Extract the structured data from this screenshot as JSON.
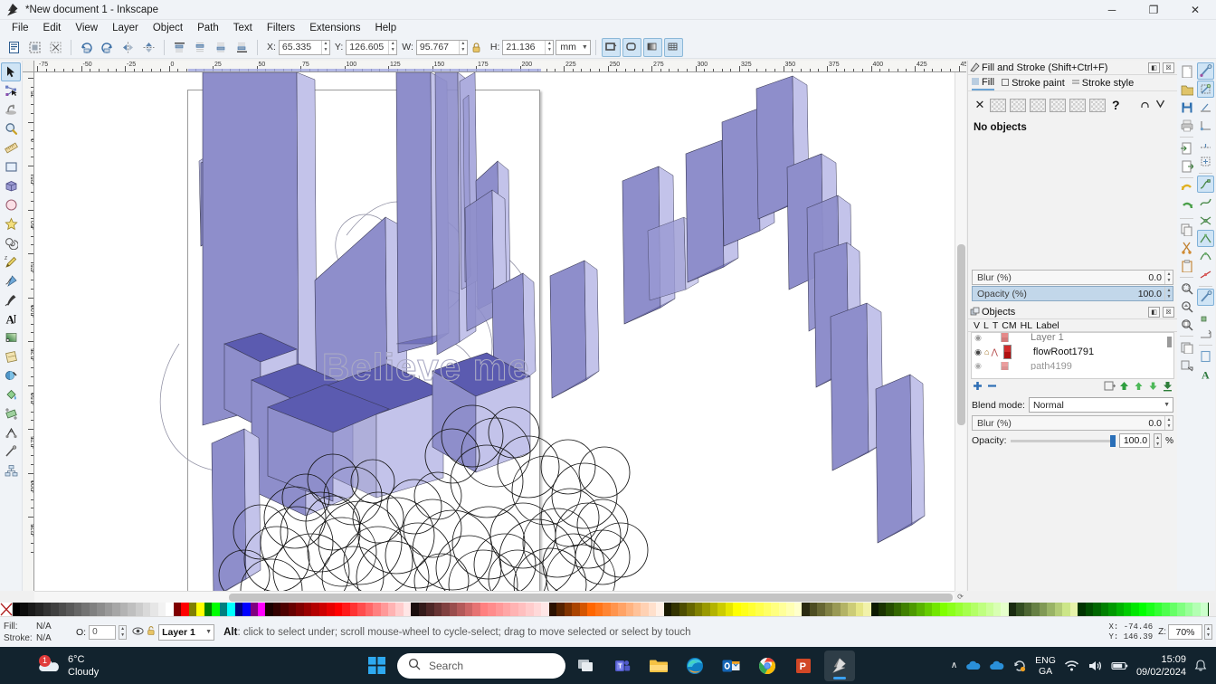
{
  "window": {
    "title": "*New document 1 - Inkscape",
    "minimize": "─",
    "maximize": "❐",
    "close": "✕"
  },
  "menu": {
    "items": [
      "File",
      "Edit",
      "View",
      "Layer",
      "Object",
      "Path",
      "Text",
      "Filters",
      "Extensions",
      "Help"
    ]
  },
  "toolbar": {
    "x_label": "X:",
    "x_value": "65.335",
    "y_label": "Y:",
    "y_value": "126.605",
    "w_label": "W:",
    "w_value": "95.767",
    "h_label": "H:",
    "h_value": "21.136",
    "unit": "mm",
    "lock_icon": "lock-icon",
    "buttons": [
      "select-all-icon",
      "select-all-layers-icon",
      "deselect-icon",
      "rotate-90-ccw-icon",
      "rotate-90-cw-icon",
      "flip-horizontal-icon",
      "flip-vertical-icon",
      "raise-to-top-icon",
      "raise-icon",
      "lower-icon",
      "lower-to-bottom-icon"
    ],
    "right_buttons": [
      "transform-stroke-icon",
      "transform-corners-icon",
      "transform-gradients-icon",
      "transform-patterns-icon"
    ]
  },
  "toolbox": {
    "tools": [
      {
        "name": "selector-tool",
        "selected": true
      },
      {
        "name": "node-tool",
        "selected": false
      },
      {
        "name": "tweak-tool",
        "selected": false
      },
      {
        "name": "zoom-tool",
        "selected": false
      },
      {
        "name": "measure-tool",
        "selected": false
      },
      {
        "name": "rectangle-tool",
        "selected": false
      },
      {
        "name": "3dbox-tool",
        "selected": false
      },
      {
        "name": "ellipse-tool",
        "selected": false
      },
      {
        "name": "star-tool",
        "selected": false
      },
      {
        "name": "spiral-tool",
        "selected": false
      },
      {
        "name": "pencil-tool",
        "selected": false
      },
      {
        "name": "bezier-tool",
        "selected": false
      },
      {
        "name": "calligraphy-tool",
        "selected": false
      },
      {
        "name": "text-tool",
        "selected": false
      },
      {
        "name": "gradient-tool",
        "selected": false
      },
      {
        "name": "mesh-tool",
        "selected": false
      },
      {
        "name": "dropper-tool",
        "selected": false
      },
      {
        "name": "paintbucket-tool",
        "selected": false
      },
      {
        "name": "eraser-tool",
        "selected": false
      },
      {
        "name": "connector-tool",
        "selected": false
      },
      {
        "name": "lpe-tool",
        "selected": false
      },
      {
        "name": "diagram-tool",
        "selected": false
      }
    ]
  },
  "rulers": {
    "h_labels": [
      "-75",
      "-50",
      "-25",
      "0",
      "25",
      "50",
      "75",
      "100",
      "125",
      "150",
      "175",
      "200",
      "225",
      "250",
      "275",
      "300",
      "325",
      "350",
      "375",
      "400",
      "425",
      "450"
    ],
    "v_labels": [
      "25",
      "0",
      "-25",
      "-50",
      "-75",
      "-100",
      "-125",
      "-150",
      "-175",
      "-200",
      "-225"
    ]
  },
  "canvas": {
    "artwork_text": "Believe me",
    "colors": {
      "box_front": "#8e8ecb",
      "box_top": "#5b5bb0",
      "box_side": "#c3c3ea",
      "box_light": "#a5a5da",
      "scribble_stroke": "#1a1a1a",
      "spiral_stroke": "#8b8b9e"
    }
  },
  "fill_stroke_panel": {
    "title": "Fill and Stroke (Shift+Ctrl+F)",
    "dock_icon": "fill-stroke-icon",
    "tabs": [
      {
        "label": "Fill",
        "icon": "fill-icon",
        "active": true
      },
      {
        "label": "Stroke paint",
        "icon": "stroke-paint-icon",
        "active": false
      },
      {
        "label": "Stroke style",
        "icon": "stroke-style-icon",
        "active": false
      }
    ],
    "paint_buttons": [
      "no-paint-icon",
      "flat-color-icon",
      "linear-gradient-icon",
      "radial-gradient-icon",
      "pattern-icon",
      "swatch-icon",
      "unknown-icon"
    ],
    "help_glyph": "?",
    "rule_icons": [
      "fill-rule-even-odd-icon",
      "fill-rule-nonzero-icon"
    ],
    "status": "No objects",
    "blur_label": "Blur (%)",
    "blur_value": "0.0",
    "opacity_label": "Opacity (%)",
    "opacity_value": "100.0",
    "minimize": "◧",
    "close": "☒"
  },
  "objects_panel": {
    "title": "Objects",
    "dock_icon": "objects-icon",
    "columns": [
      "V",
      "L",
      "T",
      "CM",
      "HL",
      "Label"
    ],
    "rows": [
      {
        "label": "Layer 1",
        "visible": true,
        "locked": false
      },
      {
        "label": "flowRoot1791",
        "visible": true,
        "locked": false
      },
      {
        "label": "path4199",
        "visible": true,
        "locked": false
      }
    ],
    "row_buttons": [
      "add-object-icon",
      "remove-object-icon",
      "new-group-icon",
      "move-to-top-icon",
      "raise-icon",
      "lower-icon",
      "move-to-bottom-icon"
    ],
    "blend_label": "Blend mode:",
    "blend_value": "Normal",
    "blur_label": "Blur (%)",
    "blur_value": "0.0",
    "opacity_label": "Opacity:",
    "opacity_value": "100.0",
    "opacity_unit": "%",
    "minimize": "◧",
    "close": "☒"
  },
  "command_icons": {
    "column1": [
      "new-document-icon",
      "open-document-icon",
      "save-document-icon",
      "print-icon",
      "import-icon",
      "export-icon",
      "undo-icon",
      "redo-icon",
      "copy-icon",
      "cut-icon",
      "paste-icon",
      "zoom-selection-icon",
      "zoom-drawing-icon",
      "zoom-page-icon",
      "duplicate-icon",
      "clone-icon"
    ],
    "column2": [
      "snap-enable-icon",
      "snap-bbox-icon",
      "snap-bbox-edge-icon",
      "snap-bbox-corner-icon",
      "snap-bbox-edge-mid-icon",
      "snap-bbox-center-icon",
      "snap-nodes-icon",
      "snap-path-icon",
      "snap-path-intersection-icon",
      "snap-cusp-node-icon",
      "snap-smooth-node-icon",
      "snap-midpoint-icon",
      "snap-others-icon",
      "snap-object-center-icon",
      "snap-rotation-center-icon",
      "snap-page-border-icon",
      "snap-grid-icon",
      "snap-guide-icon",
      "text-baseline-icon"
    ]
  },
  "statusbar": {
    "fill_label": "Fill:",
    "fill_value": "N/A",
    "stroke_label": "Stroke:",
    "stroke_value": "N/A",
    "opacity_label": "O:",
    "opacity_value": "0",
    "layer_visible_icon": "eye-icon",
    "layer_lock_icon": "unlock-icon",
    "layer_name": "Layer 1",
    "message_key": "Alt",
    "message_text": ": click to select under; scroll mouse-wheel to cycle-select; drag to move selected or select by touch",
    "coord_x_label": "X:",
    "coord_x_value": "-74.46",
    "coord_y_label": "Y:",
    "coord_y_value": "146.39",
    "zoom_label": "Z:",
    "zoom_value": "70%"
  },
  "taskbar": {
    "weather_temp": "6°C",
    "weather_cond": "Cloudy",
    "weather_badge": "1",
    "search_placeholder": "Search",
    "apps": [
      {
        "name": "start-button",
        "label": "Start"
      },
      {
        "name": "search-box",
        "label": "Search"
      },
      {
        "name": "task-view-button",
        "label": "Task View"
      },
      {
        "name": "teams-app",
        "label": "Microsoft Teams"
      },
      {
        "name": "file-explorer-app",
        "label": "File Explorer"
      },
      {
        "name": "edge-app",
        "label": "Microsoft Edge"
      },
      {
        "name": "outlook-app",
        "label": "Outlook"
      },
      {
        "name": "chrome-app",
        "label": "Google Chrome"
      },
      {
        "name": "powerpoint-app",
        "label": "PowerPoint"
      },
      {
        "name": "inkscape-app",
        "label": "Inkscape"
      }
    ],
    "tray_chevron": "∧",
    "lang_primary": "ENG",
    "lang_secondary": "GA",
    "time": "15:09",
    "date": "09/02/2024",
    "tray_icons": [
      "onedrive-icon",
      "onedrive-icon",
      "update-icon",
      "wifi-icon",
      "volume-icon",
      "battery-icon",
      "notification-icon"
    ]
  },
  "palette": {
    "none_glyph": "✕",
    "colors": [
      "#000000",
      "#0d0d0d",
      "#1a1a1a",
      "#262626",
      "#333333",
      "#404040",
      "#4d4d4d",
      "#595959",
      "#666666",
      "#737373",
      "#808080",
      "#8c8c8c",
      "#999999",
      "#a6a6a6",
      "#b3b3b3",
      "#bfbfbf",
      "#cccccc",
      "#d9d9d9",
      "#e6e6e6",
      "#f2f2f2",
      "#ffffff",
      "#800000",
      "#ff0000",
      "#808000",
      "#ffff00",
      "#008000",
      "#00ff00",
      "#008080",
      "#00ffff",
      "#000080",
      "#0000ff",
      "#800080",
      "#ff00ff",
      "#1a0000",
      "#330000",
      "#4d0000",
      "#660000",
      "#800000",
      "#990000",
      "#b30000",
      "#cc0000",
      "#e60000",
      "#ff0000",
      "#ff1a1a",
      "#ff3333",
      "#ff4d4d",
      "#ff6666",
      "#ff8080",
      "#ff9999",
      "#ffb3b3",
      "#ffcccc",
      "#ffe6e6",
      "#1a0d0d",
      "#331a1a",
      "#4d2626",
      "#663333",
      "#804040",
      "#994d4d",
      "#b35959",
      "#cc6666",
      "#e67373",
      "#ff8080",
      "#ff8c8c",
      "#ff9999",
      "#ffa6a6",
      "#ffb3b3",
      "#ffbfbf",
      "#ffcccc",
      "#ffd9d9",
      "#ffe6e6",
      "#2b1100",
      "#552200",
      "#803300",
      "#aa4400",
      "#d45500",
      "#ff6600",
      "#ff7519",
      "#ff8533",
      "#ff944d",
      "#ffa366",
      "#ffb380",
      "#ffc299",
      "#ffd1b3",
      "#ffe0cc",
      "#fff0e6",
      "#1a1a00",
      "#333300",
      "#4d4d00",
      "#666600",
      "#808000",
      "#999900",
      "#b3b300",
      "#cccc00",
      "#e6e600",
      "#ffff00",
      "#ffff1a",
      "#ffff33",
      "#ffff4d",
      "#ffff66",
      "#ffff80",
      "#ffff99",
      "#ffffb3",
      "#ffffcc",
      "#2b2b11",
      "#4d4d22",
      "#666633",
      "#808044",
      "#999955",
      "#b3b366",
      "#cccc77",
      "#e6e688",
      "#f2f2aa",
      "#0d1a00",
      "#1a3300",
      "#264d00",
      "#336600",
      "#408000",
      "#4d9900",
      "#59b300",
      "#66cc00",
      "#73e600",
      "#80ff00",
      "#8cff1a",
      "#99ff33",
      "#a6ff4d",
      "#b3ff66",
      "#bfff80",
      "#ccff99",
      "#d9ffb3",
      "#e6ffcc",
      "#1a2b11",
      "#334d22",
      "#4d6633",
      "#668044",
      "#809955",
      "#99b366",
      "#b3cc77",
      "#cce688",
      "#e6f2aa",
      "#003300",
      "#004d00",
      "#006600",
      "#008000",
      "#009900",
      "#00b300",
      "#00cc00",
      "#00e600",
      "#00ff00",
      "#1aff1a",
      "#33ff33",
      "#4dff4d",
      "#66ff66",
      "#80ff80",
      "#99ff99",
      "#b3ffb3",
      "#ccffcc",
      "#004400"
    ]
  }
}
